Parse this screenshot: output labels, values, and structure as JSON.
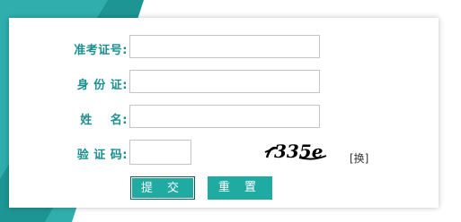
{
  "form": {
    "ticket_label": "准考证号:",
    "id_label": "身 份 证:",
    "name_label": "姓    名:",
    "captcha_label": "验 证 码:",
    "ticket_value": "",
    "id_value": "",
    "name_value": "",
    "captcha_value": "",
    "captcha_text": "335e",
    "refresh_label": "[换]"
  },
  "buttons": {
    "submit_label": "提 交",
    "reset_label": "重 置"
  },
  "colors": {
    "accent": "#1faaa2",
    "label": "#1b8e8e",
    "background": "#2aa7a7"
  }
}
